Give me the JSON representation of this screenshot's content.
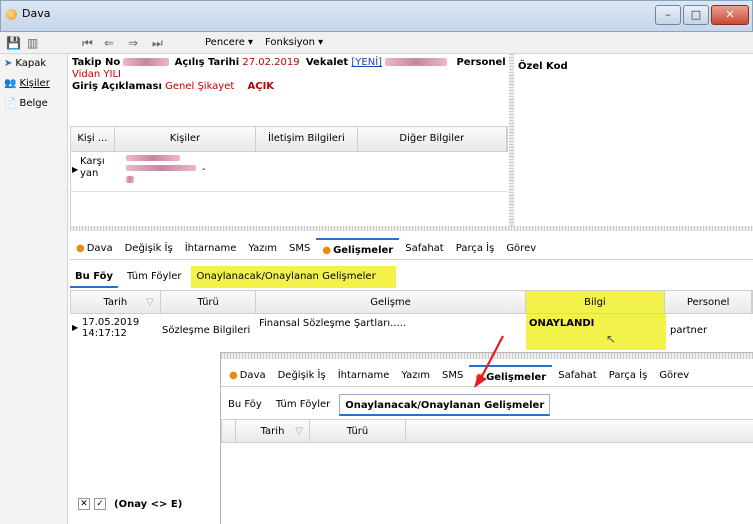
{
  "window": {
    "title": "Dava",
    "minimize": "–",
    "maximize": "□",
    "close": "✕"
  },
  "toolbar": {
    "menu_pencere": "Pencere ▾",
    "menu_fonksiyon": "Fonksiyon ▾"
  },
  "leftnav": {
    "items": [
      {
        "label": "Kapak"
      },
      {
        "label": "Kişiler"
      },
      {
        "label": "Belge"
      }
    ]
  },
  "header": {
    "takip_label": "Takip No",
    "acilis_label": "Açılış Tarihi",
    "acilis_value": "27.02.2019",
    "vekalet_label": "Vekalet",
    "vekalet_link": "[YENİ]",
    "personel_label": "Personel",
    "name_value": "Vidan YILI",
    "giris_label": "Giriş Açıklaması",
    "giris_value": "Genel Şikayet",
    "status": "AÇIK",
    "ozel_kod_label": "Özel Kod"
  },
  "persons_grid": {
    "columns": [
      "Kişi ...",
      "Kişiler",
      "İletişim Bilgileri",
      "Diğer Bilgiler"
    ],
    "row_label_1": "Karşı",
    "row_label_2": "yan",
    "row_suffix": "-"
  },
  "tabs": [
    "Dava",
    "Değişik İş",
    "İhtarname",
    "Yazım",
    "SMS",
    "Gelişmeler",
    "Safahat",
    "Parça İş",
    "Görev"
  ],
  "subtabs": [
    "Bu Föy",
    "Tüm Föyler",
    "Onaylanacak/Onaylanan Gelişmeler"
  ],
  "main_grid": {
    "columns": [
      "Tarih",
      "Türü",
      "Gelişme",
      "Bilgi",
      "Personel"
    ],
    "row": {
      "date": "17.05.2019",
      "time": "14:17:12",
      "type": "Sözleşme Bilgileri",
      "gelisme": "Finansal Sözleşme Şartları.....",
      "bilgi": "ONAYLANDI",
      "personel": "partner"
    }
  },
  "overlay": {
    "tabs": [
      "Dava",
      "Değişik İş",
      "İhtarname",
      "Yazım",
      "SMS",
      "Gelişmeler",
      "Safahat",
      "Parça İş",
      "Görev"
    ],
    "subtabs": [
      "Bu Föy",
      "Tüm Föyler",
      "Onaylanacak/Onaylanan Gelişmeler"
    ],
    "columns": [
      "Tarih",
      "Türü"
    ]
  },
  "filter": {
    "text": "(Onay <> E)",
    "clear": "✕",
    "check": "✓"
  },
  "colors": {
    "highlight": "#f3f24b",
    "tab_dot": "#e98a14",
    "arrow": "#e02020"
  }
}
